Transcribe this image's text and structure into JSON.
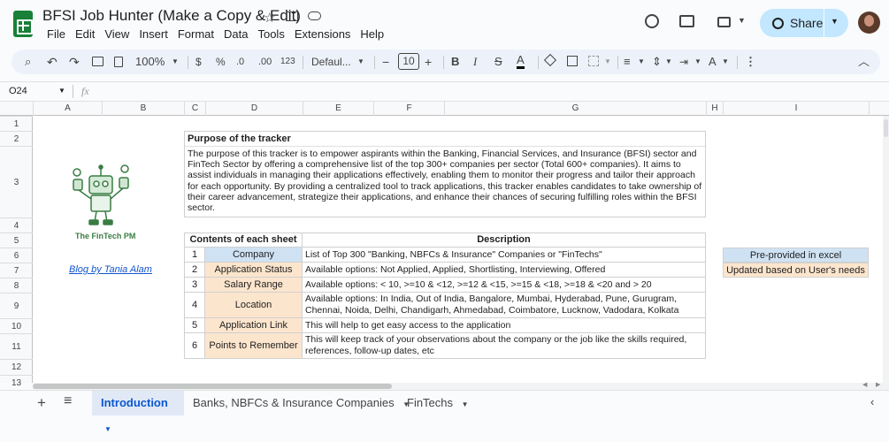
{
  "app": {
    "title": "BFSI Job Hunter (Make a Copy & Edit)",
    "share_label": "Share",
    "menu": [
      "File",
      "Edit",
      "View",
      "Insert",
      "Format",
      "Data",
      "Tools",
      "Extensions",
      "Help"
    ]
  },
  "toolbar": {
    "zoom": "100%",
    "currency": "$",
    "percent": "%",
    "dec_decrease": ".0",
    "dec_increase": ".00",
    "number_format": "123",
    "font": "Defaul...",
    "font_size": "10",
    "bold": "B",
    "italic": "I",
    "strike": "S",
    "text_color": "A"
  },
  "namebox": {
    "ref": "O24",
    "fx": "fx"
  },
  "columns": [
    "A",
    "B",
    "C",
    "D",
    "E",
    "F",
    "G",
    "H",
    "I"
  ],
  "rows": [
    "1",
    "2",
    "3",
    "4",
    "5",
    "6",
    "7",
    "8",
    "9",
    "10",
    "11",
    "12",
    "13"
  ],
  "logo": {
    "caption": "The FinTech PM"
  },
  "blog_link": "Blog by Tania Alam",
  "purpose": {
    "heading": "Purpose of the tracker",
    "text": "The purpose of this tracker is to empower aspirants within the Banking, Financial Services, and Insurance (BFSI) sector and FinTech Sector by offering a comprehensive list of the top 300+ companies per sector (Total 600+ companies). It aims to assist individuals in managing their applications effectively, enabling them to monitor their progress and tailor their approach for each opportunity. By providing a centralized tool to track applications, this tracker enables candidates to take ownership of their career advancement, strategize their applications, and enhance their chances of securing fulfilling roles within the BFSI sector."
  },
  "contents_table": {
    "header_sheet": "Contents of each sheet",
    "header_desc": "Description",
    "rows": [
      {
        "num": "1",
        "name": "Company",
        "desc": "List of Top 300 \"Banking, NBFCs & Insurance\" Companies or \"FinTechs\"",
        "type": "blue"
      },
      {
        "num": "2",
        "name": "Application Status",
        "desc": "Available options: Not Applied, Applied, Shortlisting, Interviewing, Offered",
        "type": "orange"
      },
      {
        "num": "3",
        "name": "Salary Range",
        "desc": "Available options: < 10, >=10 & <12, >=12 & <15, >=15 & <18, >=18 & <20 and > 20",
        "type": "orange"
      },
      {
        "num": "4",
        "name": "Location",
        "desc": "Available options: In India, Out of India, Bangalore, Mumbai, Hyderabad, Pune, Gurugram, Chennai, Noida, Delhi, Chandigarh, Ahmedabad, Coimbatore, Lucknow, Vadodara, Kolkata",
        "type": "orange"
      },
      {
        "num": "5",
        "name": "Application Link",
        "desc": "This will help to get easy access to the application",
        "type": "orange"
      },
      {
        "num": "6",
        "name": "Points to Remember",
        "desc": "This will keep track of your observations about the company or the job like the skills required, references, follow-up dates, etc",
        "type": "orange"
      }
    ]
  },
  "legend": {
    "blue": "Pre-provided in excel",
    "orange": "Updated based on User's needs"
  },
  "tabs": [
    {
      "label": "Introduction"
    },
    {
      "label": "Banks, NBFCs & Insurance Companies"
    },
    {
      "label": "FinTechs"
    }
  ],
  "colors": {
    "blue": "#cfe2f3",
    "orange": "#fce5cd",
    "accent": "#0b57d0",
    "share_bg": "#c2e7ff"
  }
}
